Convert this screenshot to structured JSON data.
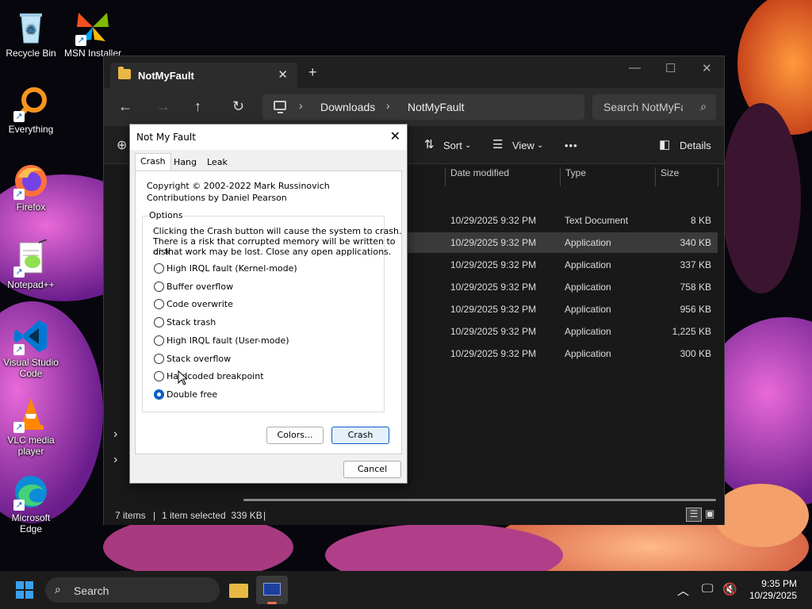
{
  "desktop": {
    "icons": [
      {
        "label": "Recycle Bin"
      },
      {
        "label": "MSN Installer"
      },
      {
        "label": "Everything"
      },
      {
        "label": "Firefox"
      },
      {
        "label": "Notepad++"
      },
      {
        "label": "Visual Studio Code"
      },
      {
        "label": "VLC media player"
      },
      {
        "label": "Microsoft Edge"
      }
    ]
  },
  "explorer": {
    "tab_title": "NotMyFault",
    "close_tab": "✕",
    "new_tab": "+",
    "breadcrumb": [
      "Downloads",
      "NotMyFault"
    ],
    "search_placeholder": "Search NotMyFault",
    "toolbar": {
      "sort": "Sort",
      "view": "View",
      "more": "•••",
      "details": "Details"
    },
    "columns": [
      "Date modified",
      "Type",
      "Size"
    ],
    "rows": [
      {
        "date": "10/29/2025 9:32 PM",
        "type": "Text Document",
        "size": "8 KB"
      },
      {
        "date": "10/29/2025 9:32 PM",
        "type": "Application",
        "size": "340 KB",
        "selected": true
      },
      {
        "date": "10/29/2025 9:32 PM",
        "type": "Application",
        "size": "337 KB"
      },
      {
        "date": "10/29/2025 9:32 PM",
        "type": "Application",
        "size": "758 KB"
      },
      {
        "date": "10/29/2025 9:32 PM",
        "type": "Application",
        "size": "956 KB"
      },
      {
        "date": "10/29/2025 9:32 PM",
        "type": "Application",
        "size": "1,225 KB"
      },
      {
        "date": "10/29/2025 9:32 PM",
        "type": "Application",
        "size": "300 KB"
      }
    ],
    "status": {
      "items": "7 items",
      "selected": "1 item selected  339 KB"
    }
  },
  "dialog": {
    "title": "Not My Fault",
    "close": "✕",
    "tabs": [
      "Crash",
      "Hang",
      "Leak"
    ],
    "copyright": "Copyright © 2002-2022 Mark Russinovich",
    "contributions": "Contributions by Daniel Pearson",
    "options_label": "Options",
    "description": [
      "Clicking the Crash button will cause the system to crash.",
      "There is a risk that corrupted memory will be written to disk",
      "or that work may be lost. Close any open applications."
    ],
    "options": [
      {
        "label": "High IRQL fault (Kernel-mode)",
        "selected": false
      },
      {
        "label": "Buffer overflow",
        "selected": false
      },
      {
        "label": "Code overwrite",
        "selected": false
      },
      {
        "label": "Stack trash",
        "selected": false
      },
      {
        "label": "High IRQL fault (User-mode)",
        "selected": false
      },
      {
        "label": "Stack overflow",
        "selected": false
      },
      {
        "label": "Hardcoded breakpoint",
        "selected": false
      },
      {
        "label": "Double free",
        "selected": true
      }
    ],
    "buttons": {
      "colors": "Colors...",
      "crash": "Crash",
      "cancel": "Cancel"
    }
  },
  "taskbar": {
    "search": "Search",
    "time": "9:35 PM",
    "date": "10/29/2025"
  },
  "colors": {
    "accent": "#0a5fc4",
    "folder": "#e8b844"
  }
}
